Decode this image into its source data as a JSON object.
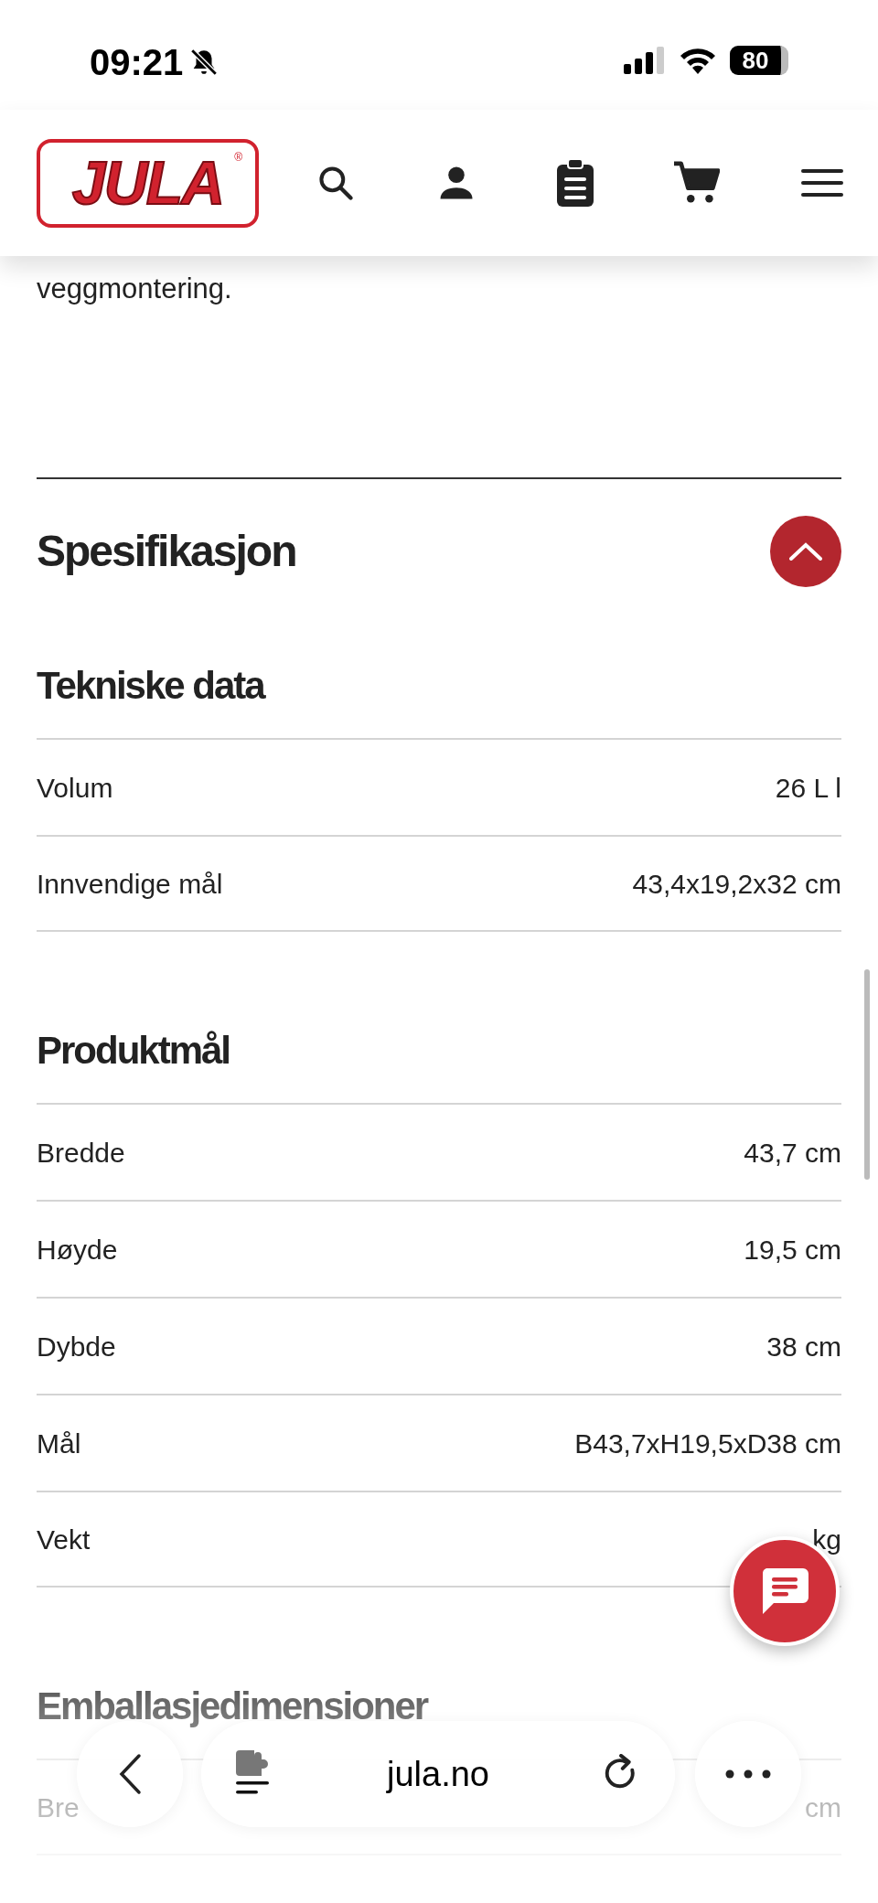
{
  "status_bar": {
    "time": "09:21",
    "battery": "80"
  },
  "header": {
    "logo": "JULA",
    "logo_mark": "®"
  },
  "intro_tail": "veggmontering.",
  "section": {
    "title": "Spesifikasjon",
    "expanded": true
  },
  "groups": [
    {
      "title": "Tekniske data",
      "rows": [
        {
          "label": "Volum",
          "value": "26 L l"
        },
        {
          "label": "Innvendige mål",
          "value": "43,4x19,2x32 cm"
        }
      ]
    },
    {
      "title": "Produktmål",
      "rows": [
        {
          "label": "Bredde",
          "value": "43,7 cm"
        },
        {
          "label": "Høyde",
          "value": "19,5 cm"
        },
        {
          "label": "Dybde",
          "value": "38 cm"
        },
        {
          "label": "Mål",
          "value": "B43,7xH19,5xD38 cm"
        },
        {
          "label": "Vekt",
          "value": "kg"
        }
      ]
    },
    {
      "title": "Emballasjedimensioner",
      "rows": [
        {
          "label": "Bre",
          "value": "cm"
        }
      ]
    }
  ],
  "browser_bar": {
    "url": "jula.no"
  }
}
